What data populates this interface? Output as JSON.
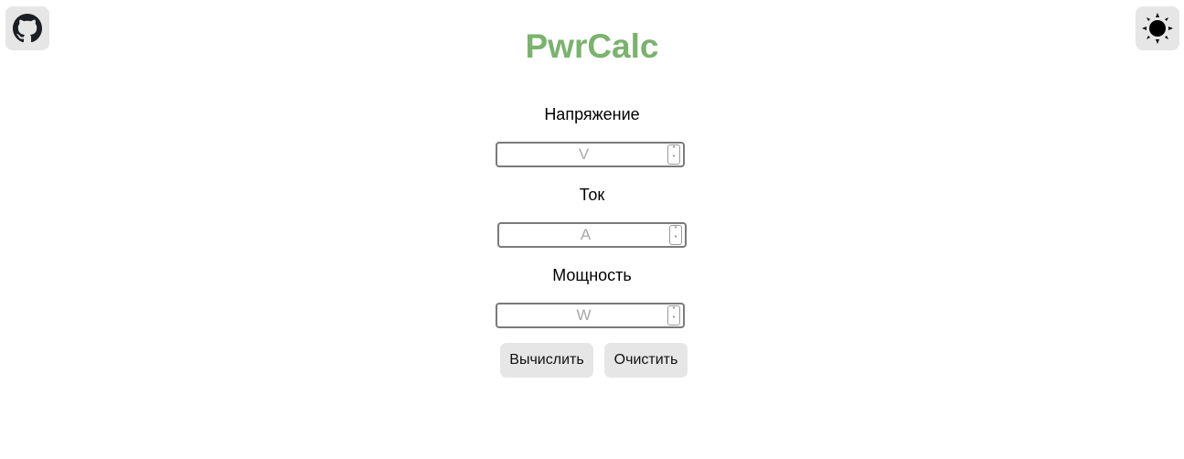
{
  "app": {
    "title": "PwrCalc",
    "title_color": "#7bb26f"
  },
  "header": {
    "github_icon": "github-icon",
    "theme_icon": "sun-icon"
  },
  "fields": {
    "voltage": {
      "label": "Напряжение",
      "placeholder": "V",
      "value": ""
    },
    "current": {
      "label": "Ток",
      "placeholder": "A",
      "value": ""
    },
    "power": {
      "label": "Мощность",
      "placeholder": "W",
      "value": ""
    }
  },
  "actions": {
    "calculate_label": "Вычислить",
    "clear_label": "Очистить"
  }
}
